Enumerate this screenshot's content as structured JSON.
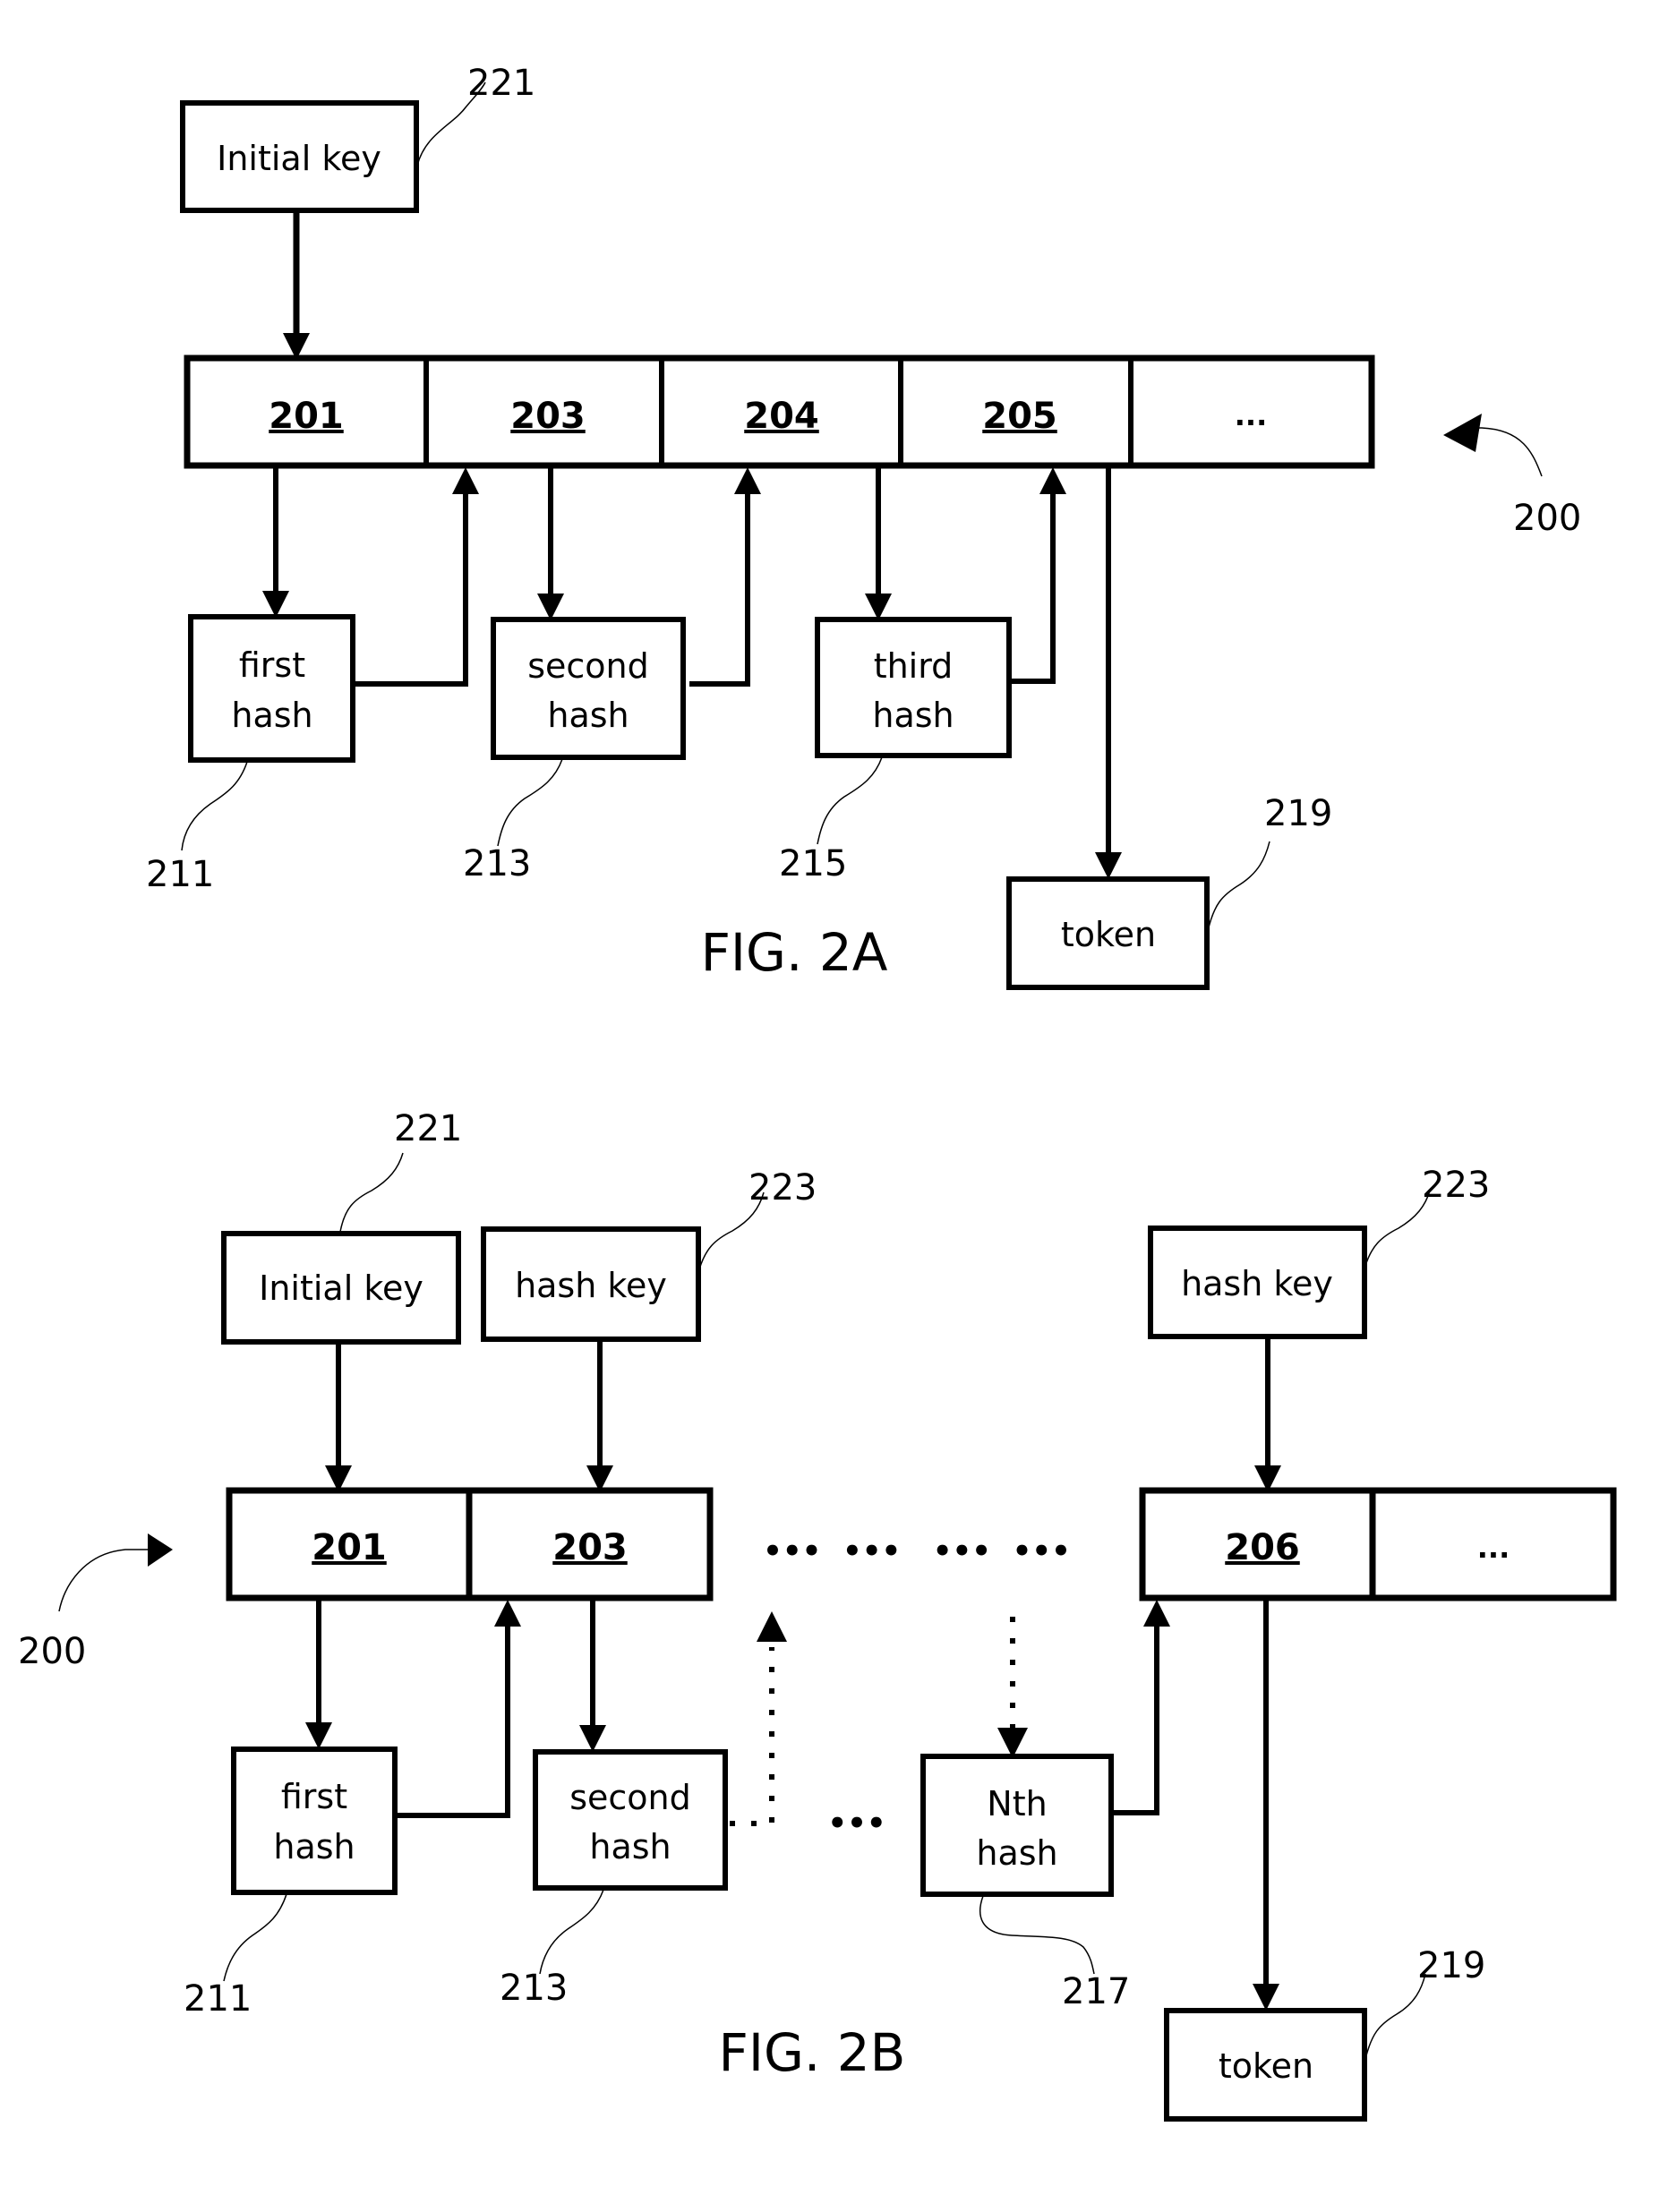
{
  "fig_2a": {
    "caption": "FIG. 2A",
    "initial_key": {
      "label": "Initial key",
      "ref": "221"
    },
    "array_cells": [
      "201",
      "203",
      "204",
      "205",
      "..."
    ],
    "array_ref": "200",
    "hashes": [
      {
        "line1": "first",
        "line2": "hash",
        "ref": "211"
      },
      {
        "line1": "second",
        "line2": "hash",
        "ref": "213"
      },
      {
        "line1": "third",
        "line2": "hash",
        "ref": "215"
      }
    ],
    "token": {
      "label": "token",
      "ref": "219"
    }
  },
  "fig_2b": {
    "caption": "FIG. 2B",
    "initial_key": {
      "label": "Initial key",
      "ref": "221"
    },
    "hash_key_1": {
      "label": "hash key",
      "ref": "223"
    },
    "hash_key_2": {
      "label": "hash key",
      "ref": "223"
    },
    "array_cells_left": [
      "201",
      "203"
    ],
    "array_cells_right": [
      "206",
      "..."
    ],
    "array_gap": "•••  •••   •••  •••",
    "array_ref": "200",
    "hashes": [
      {
        "line1": "first",
        "line2": "hash",
        "ref": "211"
      },
      {
        "line1": "second",
        "line2": "hash",
        "ref": "213"
      },
      {
        "line1": "Nth",
        "line2": "hash",
        "ref": "217"
      }
    ],
    "hash_gap": "•••",
    "token": {
      "label": "token",
      "ref": "219"
    }
  }
}
